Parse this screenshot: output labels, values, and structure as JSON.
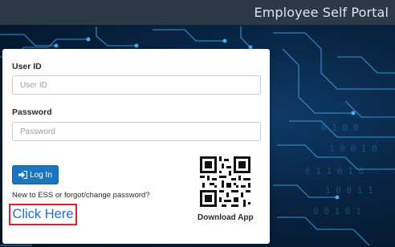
{
  "header": {
    "title": "Employee Self Portal"
  },
  "login": {
    "user_id_label": "User ID",
    "user_id_placeholder": "User ID",
    "password_label": "Password",
    "password_placeholder": "Password",
    "login_button": "Log In",
    "help_text": "New to ESS or forgot/change password?",
    "click_here": "Click Here",
    "download_label": "Download App"
  },
  "colors": {
    "header_bg": "#2c3a47",
    "primary_button": "#1b76c0",
    "link": "#1f6fd1",
    "highlight_border": "#d9252b"
  }
}
